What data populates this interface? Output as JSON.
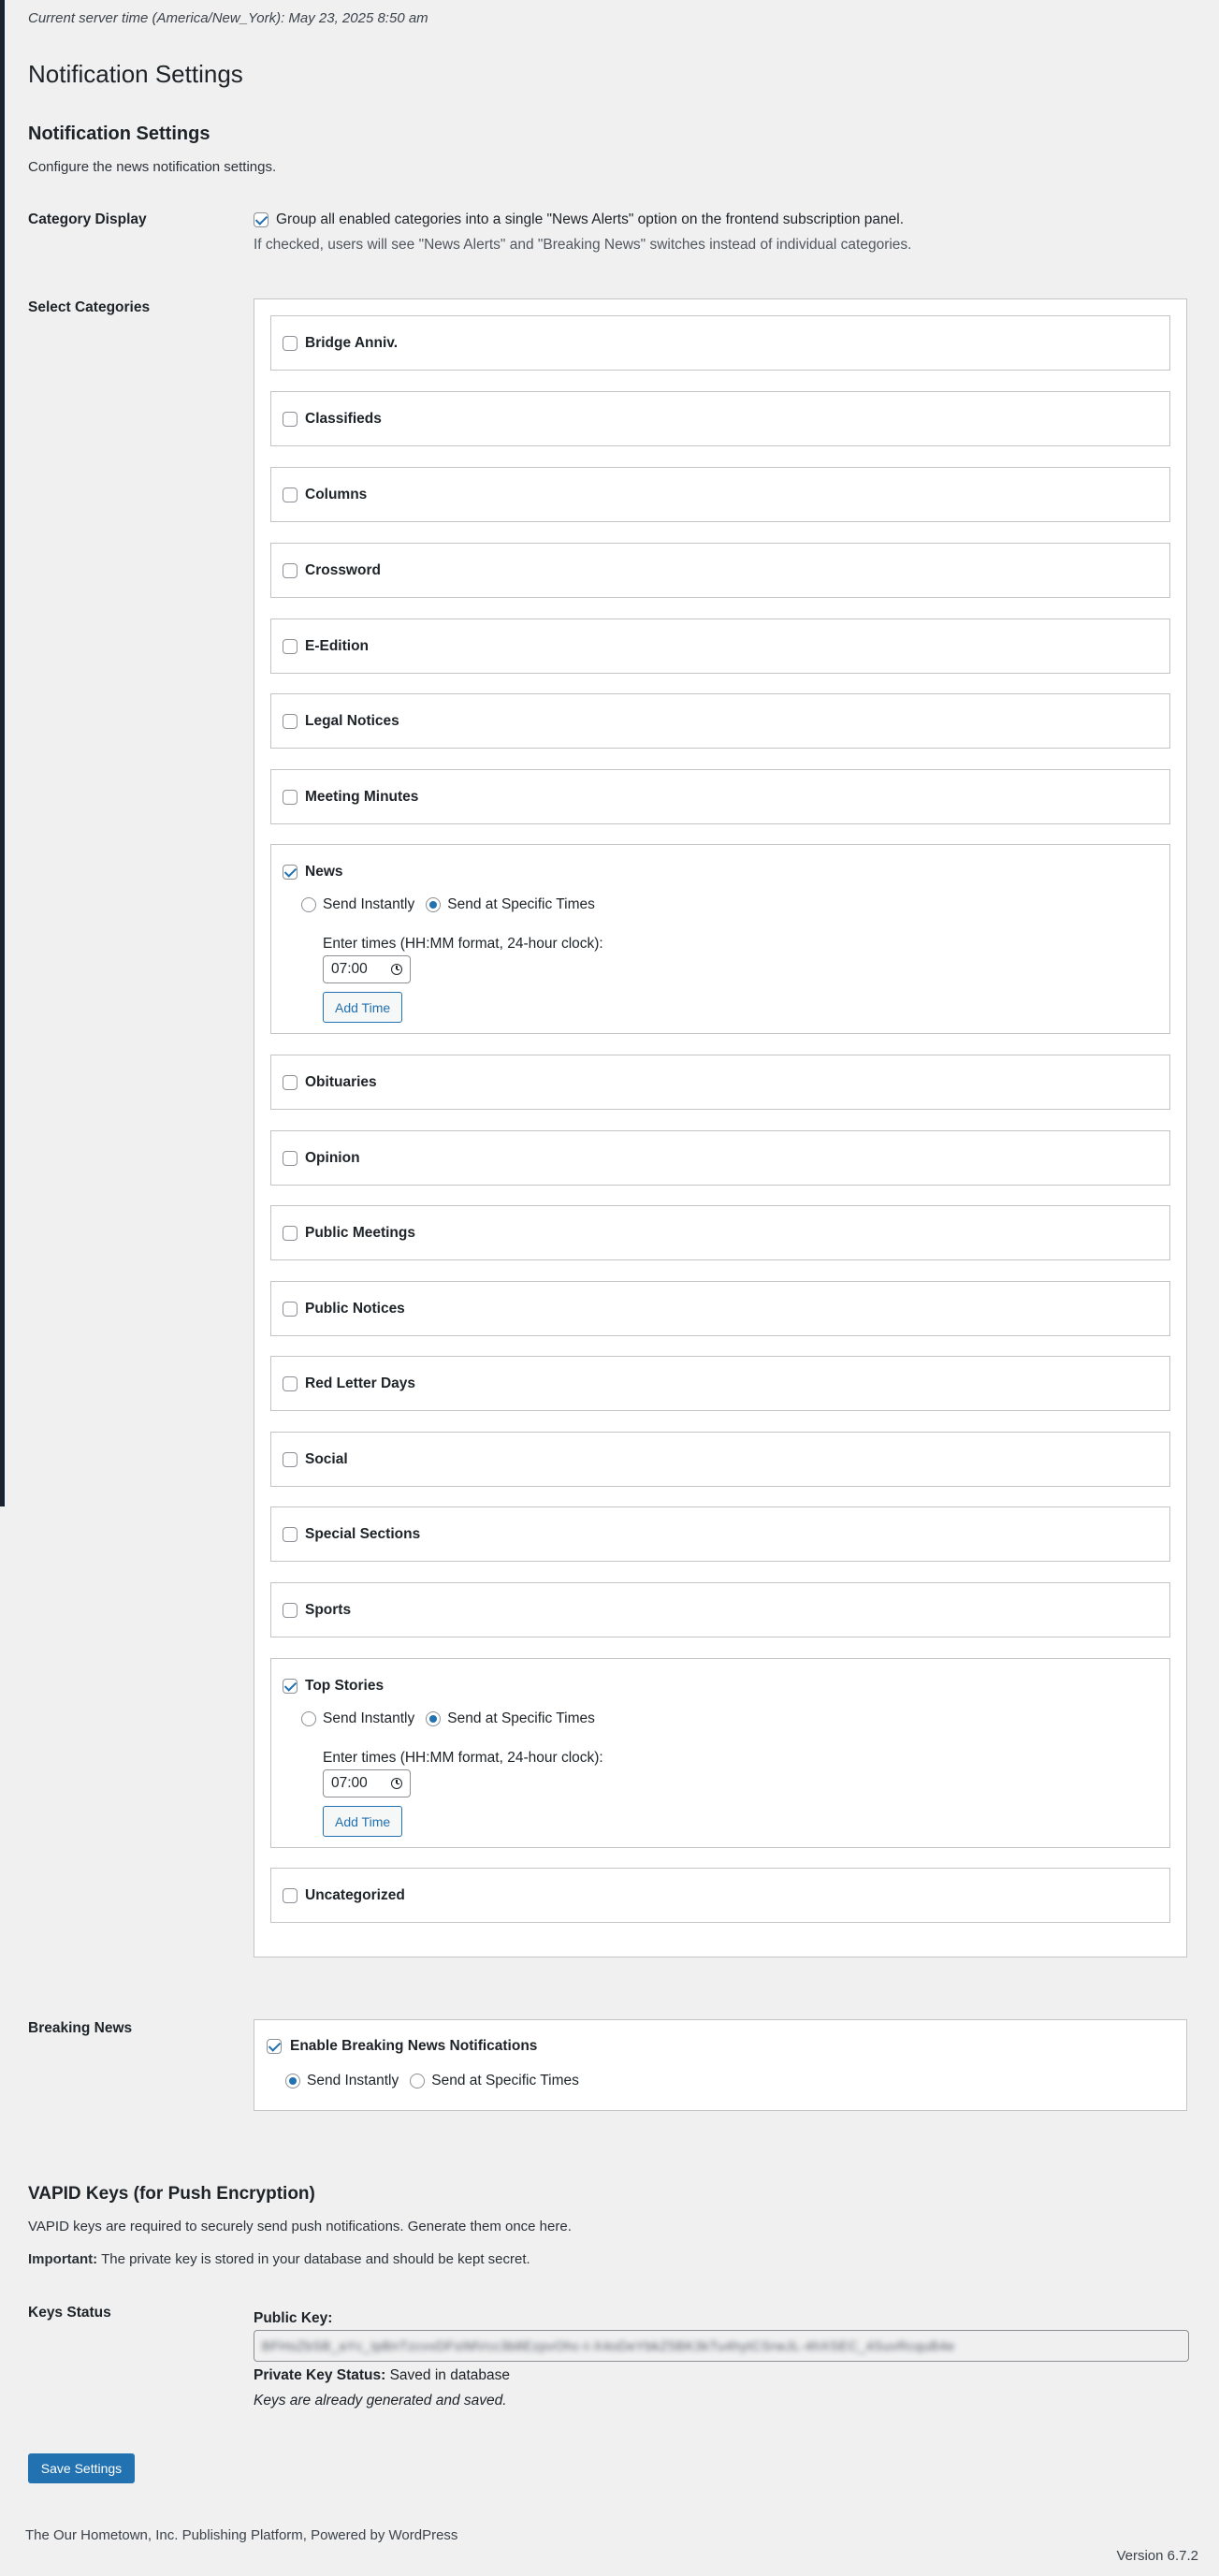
{
  "server_time": "Current server time (America/New_York): May 23, 2025 8:50 am",
  "page_title": "Notification Settings",
  "notification_section": {
    "title": "Notification Settings",
    "description": "Configure the news notification settings."
  },
  "category_display": {
    "label": "Category Display",
    "checkbox_label": "Group all enabled categories into a single \"News Alerts\" option on the frontend subscription panel.",
    "checked": true,
    "help": "If checked, users will see \"News Alerts\" and \"Breaking News\" switches instead of individual categories."
  },
  "select_categories": {
    "label": "Select Categories",
    "items": [
      {
        "name": "Bridge Anniv."
      },
      {
        "name": "Classifieds"
      },
      {
        "name": "Columns"
      },
      {
        "name": "Crossword"
      },
      {
        "name": "E-Edition"
      },
      {
        "name": "Legal Notices"
      },
      {
        "name": "Meeting Minutes"
      },
      {
        "name": "News",
        "send_instantly": "Send Instantly",
        "send_specific": "Send at Specific Times",
        "times_label": "Enter times (HH:MM format, 24-hour clock):",
        "time": "07:00",
        "add_time": "Add Time"
      },
      {
        "name": "Obituaries"
      },
      {
        "name": "Opinion"
      },
      {
        "name": "Public Meetings"
      },
      {
        "name": "Public Notices"
      },
      {
        "name": "Red Letter Days"
      },
      {
        "name": "Social"
      },
      {
        "name": "Special Sections"
      },
      {
        "name": "Sports"
      },
      {
        "name": "Top Stories",
        "send_instantly": "Send Instantly",
        "send_specific": "Send at Specific Times",
        "times_label": "Enter times (HH:MM format, 24-hour clock):",
        "time": "07:00",
        "add_time": "Add Time"
      },
      {
        "name": "Uncategorized"
      }
    ]
  },
  "breaking_news": {
    "label": "Breaking News",
    "checkbox_label": "Enable Breaking News Notifications",
    "send_instantly": "Send Instantly",
    "send_specific": "Send at Specific Times"
  },
  "vapid": {
    "title": "VAPID Keys (for Push Encryption)",
    "description": "VAPID keys are required to securely send push notifications. Generate them once here.",
    "important_label": "Important:",
    "important_text": " The private key is stored in your database and should be kept secret.",
    "keys_status_label": "Keys Status",
    "public_key_label": "Public Key:",
    "public_key_value": "BFHsZbSB_aYc_IpBnTzcvvDFsIMVcc3b8EzpvOhc-t-X4oDeYbkZ5BK3kTu4hytCSrwJL-4hXSEC_4SuvRcquB4e",
    "private_status_label": "Private Key Status:",
    "private_status_value": " Saved in database",
    "note": "Keys are already generated and saved."
  },
  "save_button": "Save Settings",
  "footer": {
    "left": "The Our Hometown, Inc. Publishing Platform, Powered by WordPress",
    "version": "Version 6.7.2"
  }
}
